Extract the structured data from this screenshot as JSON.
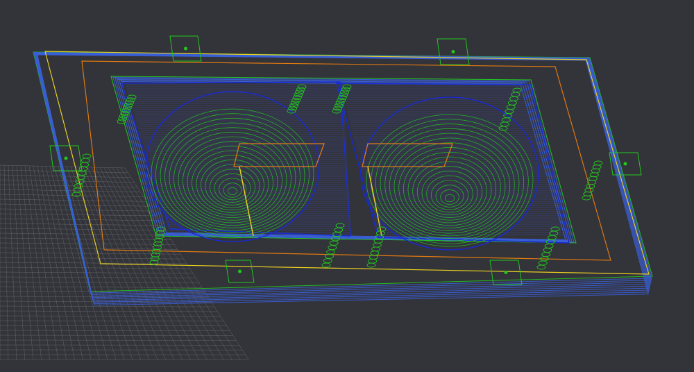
{
  "colors": {
    "background": "#33333a",
    "grid": "#8a8a90",
    "outline_blue": "#3a5fd8",
    "deep_blue": "#1a2ad0",
    "green": "#22c81e",
    "orange": "#e07a10",
    "yellow": "#e8d020",
    "red": "#c84a20"
  },
  "viewport": {
    "pockets": 2,
    "tabs": 6,
    "pocket_rings": 18
  }
}
